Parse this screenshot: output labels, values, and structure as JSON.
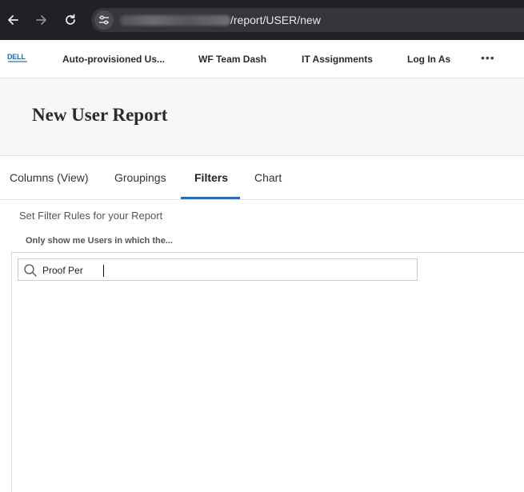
{
  "browser": {
    "url_visible": "/report/USER/new"
  },
  "app_nav": {
    "logo_text": "DELL",
    "items": [
      {
        "label": "Auto-provisioned Us..."
      },
      {
        "label": "WF Team Dash"
      },
      {
        "label": "IT Assignments"
      },
      {
        "label": "Log In As"
      }
    ],
    "more_label": "•••"
  },
  "page": {
    "title": "New User Report"
  },
  "tabs": [
    {
      "label": "Columns (View)",
      "active": false
    },
    {
      "label": "Groupings",
      "active": false
    },
    {
      "label": "Filters",
      "active": true
    },
    {
      "label": "Chart",
      "active": false
    }
  ],
  "filters": {
    "subtitle": "Set Filter Rules for your Report",
    "only_show": "Only show me Users in which the...",
    "search_value": "Proof Per",
    "accent_color": "#1d6fc9"
  }
}
